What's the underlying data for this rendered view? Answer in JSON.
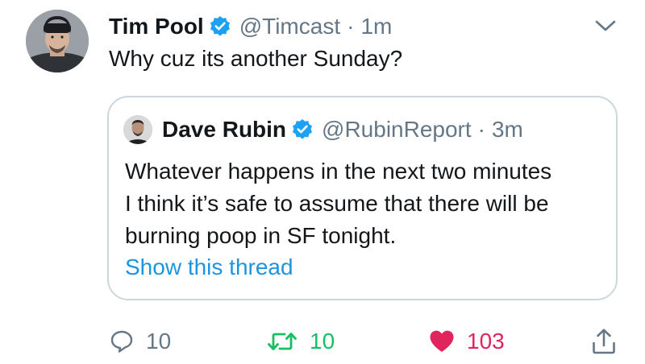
{
  "tweet": {
    "author_name": "Tim Pool",
    "author_handle": "@Timcast",
    "separator": "·",
    "time": "1m",
    "text": "Why cuz its another Sunday?",
    "verified_icon": "verified-badge-icon",
    "menu_icon": "chevron-down-icon"
  },
  "quoted": {
    "author_name": "Dave Rubin",
    "author_handle": "@RubinReport",
    "separator": "·",
    "time": "3m",
    "lines": [
      "Whatever happens in the next two minutes",
      "I think it’s safe to assume that there will be",
      "burning poop in SF tonight."
    ],
    "show_thread": "Show this thread"
  },
  "actions": {
    "replies": "10",
    "retweets": "10",
    "likes": "103"
  },
  "colors": {
    "verified": "#1da1f2",
    "link": "#1b95e0",
    "retweet": "#17bf63",
    "like": "#e0245e",
    "muted": "#657786",
    "border": "#ccd6dd"
  }
}
